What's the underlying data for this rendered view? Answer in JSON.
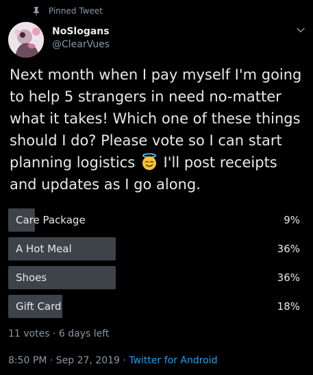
{
  "pinned": {
    "label": "Pinned Tweet"
  },
  "author": {
    "display_name": "NoSlogans",
    "handle": "@ClearVues"
  },
  "tweet": {
    "text_part1": "Next month when I pay myself I'm going\nto help 5 strangers in need no-matter\nwhat it takes! Which one of these things\nshould I do? Please vote so I can start\nplanning logistics ",
    "emoji_icon": "smiling-face-with-halo-icon",
    "text_part2": " I'll post receipts\nand updates as I go along."
  },
  "poll": {
    "options": [
      {
        "label": "Care Package",
        "percent_text": "9%",
        "percent": 9
      },
      {
        "label": "A Hot Meal",
        "percent_text": "36%",
        "percent": 36
      },
      {
        "label": "Shoes",
        "percent_text": "36%",
        "percent": 36
      },
      {
        "label": "Gift Card",
        "percent_text": "18%",
        "percent": 18
      }
    ],
    "meta": {
      "votes": "11 votes",
      "separator": " · ",
      "time_left": "6 days left"
    }
  },
  "footer": {
    "time": "8:50 PM",
    "separator1": " · ",
    "date": "Sep 27, 2019",
    "separator2": " · ",
    "source": "Twitter for Android"
  },
  "colors": {
    "background": "#000000",
    "bar": "#3d4348",
    "muted_text": "#8899a6",
    "link": "#1da1f2",
    "primary_text": "#e7e9ea"
  }
}
